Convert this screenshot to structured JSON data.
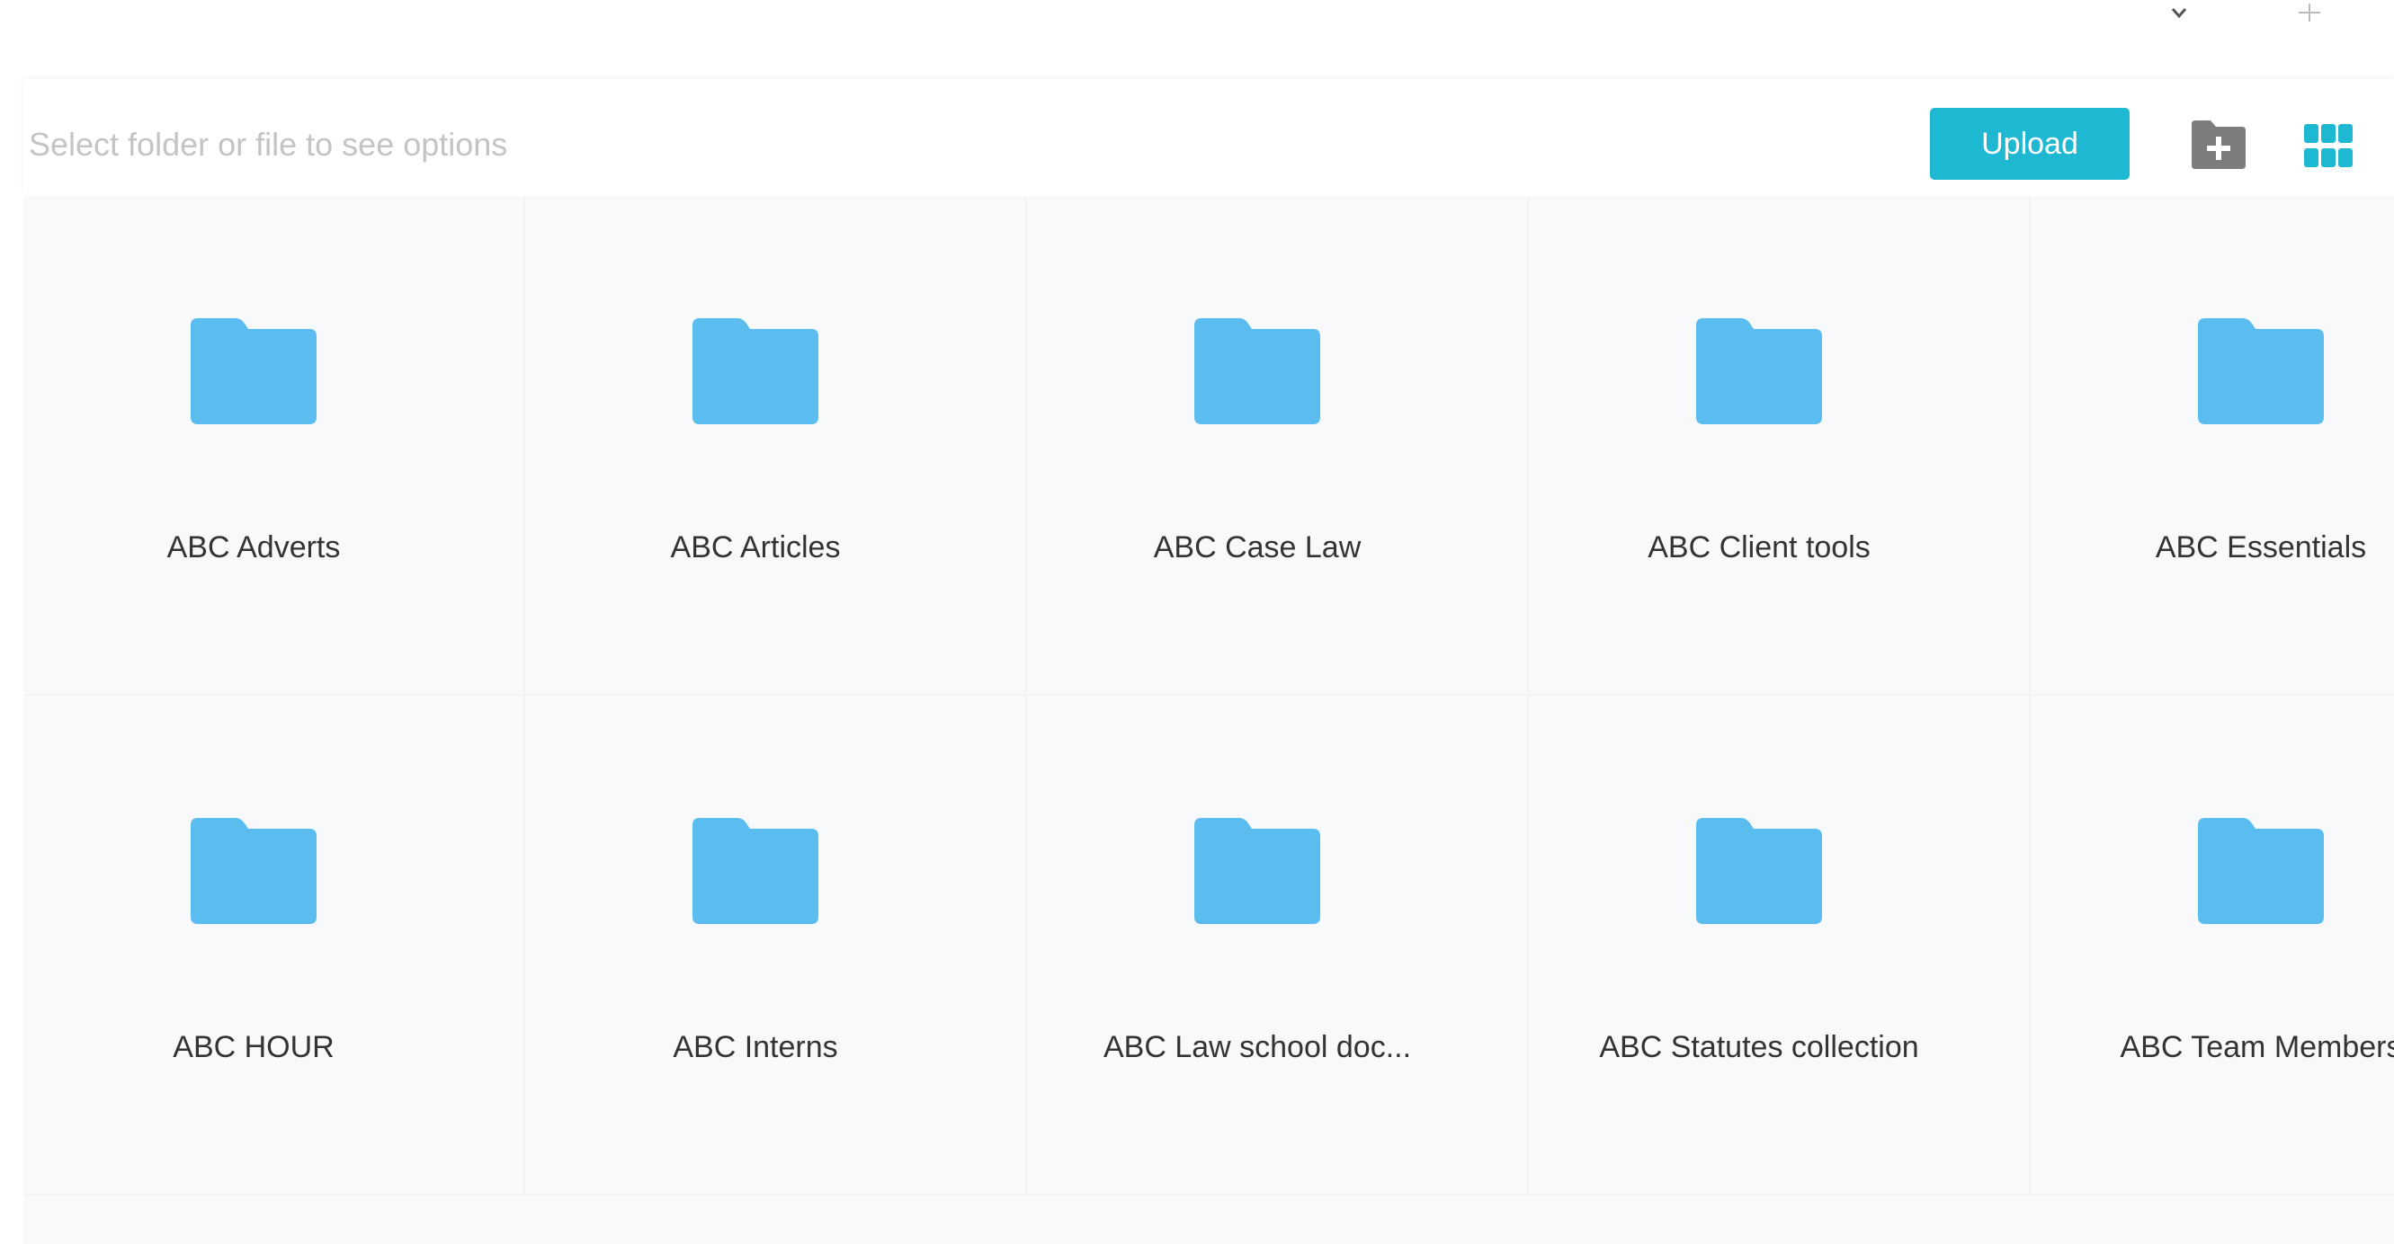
{
  "toolbar": {
    "hint": "Select folder or file to see options",
    "upload_label": "Upload"
  },
  "icons": {
    "window_chevron": "chevron-down-icon",
    "window_plus": "plus-icon",
    "new_folder": "folder-plus-icon",
    "grid_view": "grid-view-icon",
    "folder": "folder-icon"
  },
  "colors": {
    "accent": "#1fb8d2",
    "folder": "#5bbcf0",
    "grid_background": "#f8f9fa",
    "hint_text": "#c4c4c4"
  },
  "folders": [
    {
      "name": "ABC Adverts"
    },
    {
      "name": "ABC Articles"
    },
    {
      "name": "ABC Case Law"
    },
    {
      "name": "ABC Client tools"
    },
    {
      "name": "ABC Essentials"
    },
    {
      "name": "ABC HOUR"
    },
    {
      "name": "ABC Interns"
    },
    {
      "name": "ABC Law school doc..."
    },
    {
      "name": "ABC Statutes collection"
    },
    {
      "name": "ABC Team Members"
    }
  ]
}
